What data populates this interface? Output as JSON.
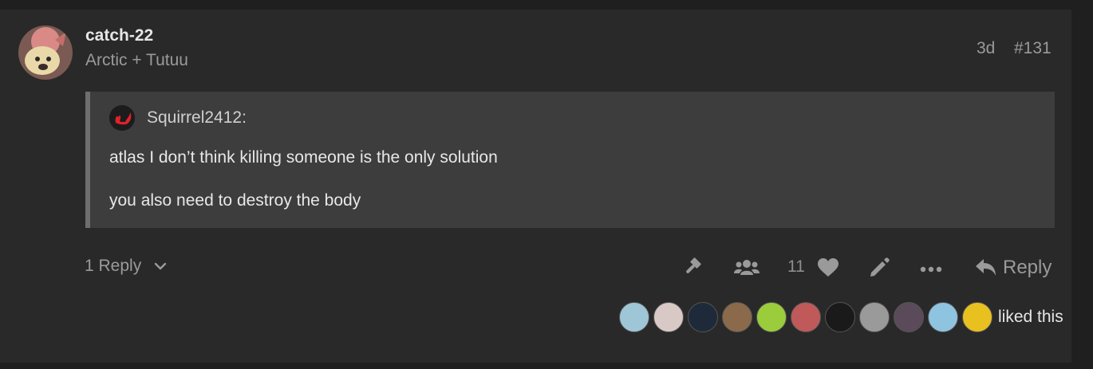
{
  "post": {
    "username": "catch-22",
    "user_title": "Arctic + Tutuu",
    "date": "3d",
    "number": "#131"
  },
  "quote": {
    "author": "Squirrel2412:",
    "lines": [
      "atlas I don’t think killing someone is the only solution",
      "you also need to destroy the body"
    ]
  },
  "actions": {
    "replies_label": "1 Reply",
    "like_count": "11",
    "reply_label": "Reply"
  },
  "likes": {
    "text": "liked this",
    "avatar_colors": [
      "#9fc6d6",
      "#d9c9c6",
      "#1e2a3a",
      "#8a6a4a",
      "#9acc3c",
      "#c05a5a",
      "#1a1a1a",
      "#9a9a9a",
      "#5a4a5a",
      "#8ec4e0",
      "#e8c020"
    ]
  },
  "colors": {
    "background": "#292929",
    "quote_background": "#3d3d3d",
    "muted_text": "#9a9a9a"
  }
}
